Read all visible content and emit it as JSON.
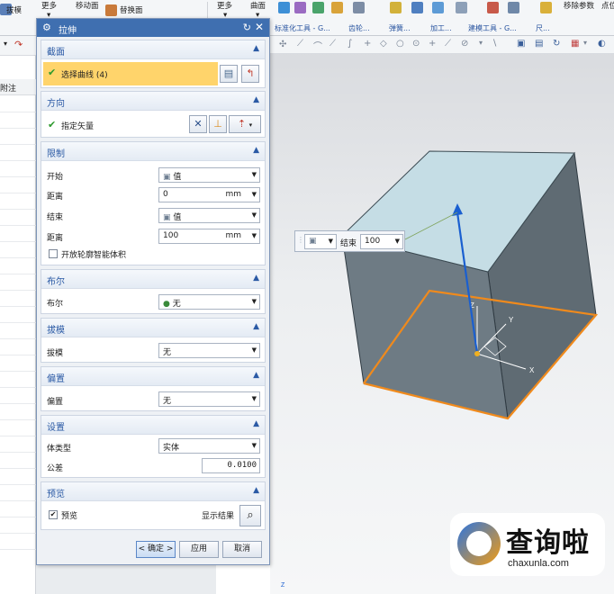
{
  "ribbon": {
    "draft_label": "拔模",
    "more_label_1": "更多",
    "move_face_label": "移动面",
    "replace_face_label": "替换面",
    "more_label_2": "更多",
    "surface_label": "曲面",
    "remove_params_label": "移除参数",
    "point_label": "点位",
    "groups": [
      "标准化工具 - G...",
      "齿轮...",
      "弹簧...",
      "加工...",
      "建模工具 - G...",
      "尺..."
    ]
  },
  "dialog": {
    "title": "拉伸",
    "section_label": "截面",
    "select_curve_label": "选择曲线 (4)",
    "direction_label": "方向",
    "specify_vector_label": "指定矢量",
    "limits_label": "限制",
    "start_label": "开始",
    "start_value": "值",
    "distance_label_1": "距离",
    "distance_value_1": "0",
    "distance_unit_1": "mm",
    "end_label": "结束",
    "end_value": "值",
    "distance_label_2": "距离",
    "distance_value_2": "100",
    "distance_unit_2": "mm",
    "open_profile_label": "开放轮廓智能体积",
    "boolean_section_label": "布尔",
    "boolean_label": "布尔",
    "boolean_value": "无",
    "draft_section_label": "拔模",
    "draft_label": "拔模",
    "draft_value": "无",
    "offset_section_label": "偏置",
    "offset_label": "偏置",
    "offset_value": "无",
    "settings_section_label": "设置",
    "body_type_label": "体类型",
    "body_type_value": "实体",
    "tolerance_label": "公差",
    "tolerance_value": "0.0100",
    "preview_section_label": "预览",
    "preview_label": "预览",
    "preview_checked": true,
    "show_result_label": "显示结果",
    "ok_label": "< 确定 >",
    "apply_label": "应用",
    "cancel_label": "取消"
  },
  "left_panel": {
    "header_label": "附注"
  },
  "float_toolbar": {
    "end_label": "结束",
    "end_value": "100"
  },
  "viewport": {
    "axis_x": "X",
    "axis_y": "Y",
    "axis_z": "Z"
  },
  "watermark": {
    "brand": "查询啦",
    "url": "chaxunla.com"
  },
  "colors": {
    "title_bar": "#3f6fb0",
    "section_header_text": "#2b5aa5",
    "selected_row": "#ffd46b",
    "edge_highlight": "#f08a1c",
    "vector_arrow": "#1a5fd0"
  }
}
